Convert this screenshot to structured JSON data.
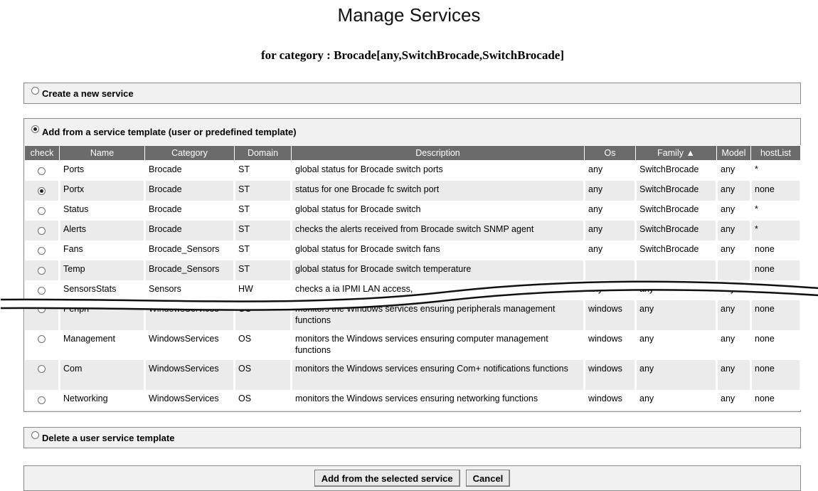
{
  "page": {
    "title": "Manage Services",
    "subtitle": "for category : Brocade[any,SwitchBrocade,SwitchBrocade]"
  },
  "options": {
    "create": "Create a new service",
    "add_template": "Add from a service template (user or predefined template)",
    "delete": "Delete a user service template"
  },
  "table": {
    "headers": {
      "check": "check",
      "name": "Name",
      "category": "Category",
      "domain": "Domain",
      "description": "Description",
      "os": "Os",
      "family": "Family ▲",
      "model": "Model",
      "hostlist": "hostList"
    },
    "rows": [
      {
        "selected": false,
        "name": "Ports",
        "category": "Brocade",
        "domain": "ST",
        "description": "global status for Brocade switch ports",
        "os": "any",
        "family": "SwitchBrocade",
        "model": "any",
        "hostlist": "*"
      },
      {
        "selected": true,
        "name": "Portx",
        "category": "Brocade",
        "domain": "ST",
        "description": "status for one Brocade fc switch port",
        "os": "any",
        "family": "SwitchBrocade",
        "model": "any",
        "hostlist": "none"
      },
      {
        "selected": false,
        "name": "Status",
        "category": "Brocade",
        "domain": "ST",
        "description": "global status for Brocade switch",
        "os": "any",
        "family": "SwitchBrocade",
        "model": "any",
        "hostlist": "*"
      },
      {
        "selected": false,
        "name": "Alerts",
        "category": "Brocade",
        "domain": "ST",
        "description": "checks the alerts received from Brocade switch SNMP agent",
        "os": "any",
        "family": "SwitchBrocade",
        "model": "any",
        "hostlist": "*"
      },
      {
        "selected": false,
        "name": "Fans",
        "category": "Brocade_Sensors",
        "domain": "ST",
        "description": "global status for Brocade switch fans",
        "os": "any",
        "family": "SwitchBrocade",
        "model": "any",
        "hostlist": "none"
      },
      {
        "selected": false,
        "name": "Temp",
        "category": "Brocade_Sensors",
        "domain": "ST",
        "description": "global status for Brocade switch temperature",
        "os": "",
        "family": "",
        "model": "",
        "hostlist": "none"
      },
      {
        "selected": false,
        "name": "SensorsStats",
        "category": "Sensors",
        "domain": "HW",
        "description": "checks a                               ia IPMI LAN access,",
        "os": "any",
        "family": "any",
        "model": "any",
        "hostlist": "none"
      },
      {
        "selected": false,
        "name": "Periph",
        "category": "WindowsServices",
        "domain": "OS",
        "description": "monitors the Windows services ensuring peripherals management functions",
        "os": "windows",
        "family": "any",
        "model": "any",
        "hostlist": "none"
      },
      {
        "selected": false,
        "name": "Management",
        "category": "WindowsServices",
        "domain": "OS",
        "description": "monitors the Windows services ensuring computer management functions",
        "os": "windows",
        "family": "any",
        "model": "any",
        "hostlist": "none"
      },
      {
        "selected": false,
        "name": "Com",
        "category": "WindowsServices",
        "domain": "OS",
        "description": "monitors the Windows services ensuring Com+ notifications functions",
        "os": "windows",
        "family": "any",
        "model": "any",
        "hostlist": "none"
      },
      {
        "selected": false,
        "name": "Networking",
        "category": "WindowsServices",
        "domain": "OS",
        "description": "monitors the Windows services ensuring networking functions",
        "os": "windows",
        "family": "any",
        "model": "any",
        "hostlist": "none"
      }
    ]
  },
  "buttons": {
    "add": "Add from the selected service",
    "cancel": "Cancel"
  }
}
